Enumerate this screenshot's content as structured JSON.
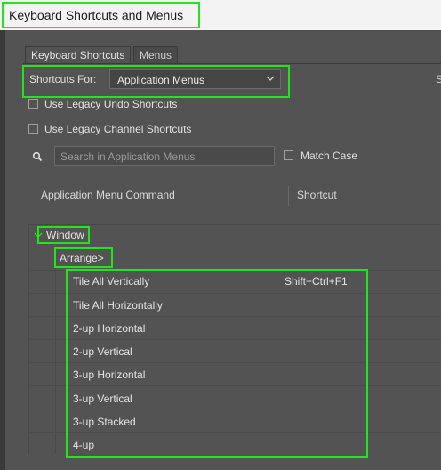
{
  "window": {
    "title": "Keyboard Shortcuts and Menus"
  },
  "tabs": [
    "Keyboard Shortcuts",
    "Menus"
  ],
  "shortcuts_for": {
    "label": "Shortcuts For:",
    "value": "Application Menus"
  },
  "right_clip_text": "S",
  "checkboxes": {
    "legacy_undo": "Use Legacy Undo Shortcuts",
    "legacy_channel": "Use Legacy Channel Shortcuts",
    "match_case": "Match Case"
  },
  "search": {
    "placeholder": "Search in Application Menus"
  },
  "table": {
    "headers": [
      "Application Menu Command",
      "Shortcut"
    ],
    "window_label": "Window",
    "arrange_label": "Arrange>",
    "items": [
      {
        "command": "Tile All Vertically",
        "shortcut": "Shift+Ctrl+F1"
      },
      {
        "command": "Tile All Horizontally",
        "shortcut": ""
      },
      {
        "command": "2-up Horizontal",
        "shortcut": ""
      },
      {
        "command": "2-up Vertical",
        "shortcut": ""
      },
      {
        "command": "3-up Horizontal",
        "shortcut": ""
      },
      {
        "command": "3-up Vertical",
        "shortcut": ""
      },
      {
        "command": "3-up Stacked",
        "shortcut": ""
      },
      {
        "command": "4-up",
        "shortcut": ""
      }
    ]
  },
  "colors": {
    "highlight": "#22e41c",
    "panel": "#535353",
    "titlebar": "#f3f3f3"
  }
}
